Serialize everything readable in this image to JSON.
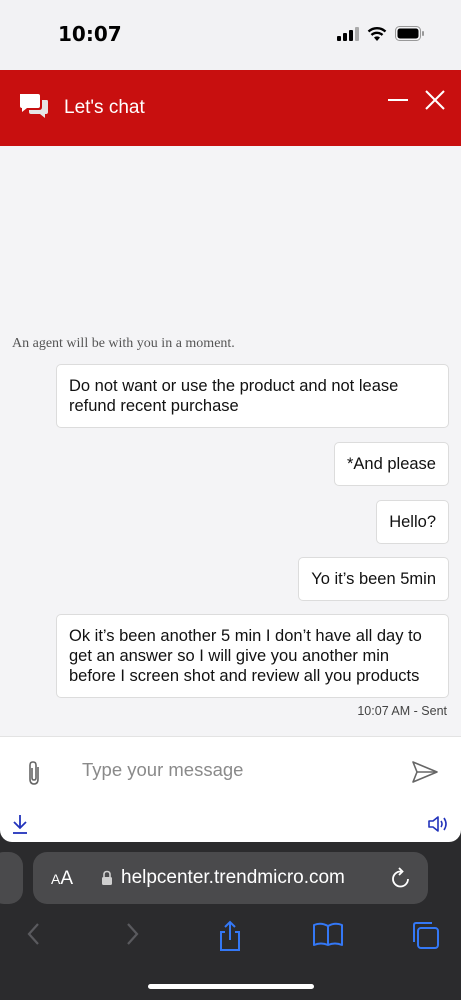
{
  "status_bar": {
    "time": "10:07"
  },
  "header": {
    "title": "Let's chat",
    "color": "#c80f0f"
  },
  "chat": {
    "agent_note": "An agent will be with you in a moment.",
    "messages": [
      {
        "text": "Do not want or use the product and not lease refund recent purchase"
      },
      {
        "text": "*And please"
      },
      {
        "text": "Hello?"
      },
      {
        "text": "Yo it’s been 5min"
      },
      {
        "text": "Ok it’s been another 5 min I don’t have all day to get an answer so I will give you another min before I screen shot and review all you products"
      }
    ],
    "sent_meta": "10:07 AM - Sent"
  },
  "composer": {
    "placeholder": "Type your message"
  },
  "browser": {
    "aa_big": "A",
    "aa_small": "A",
    "url": "helpcenter.trendmicro.com"
  },
  "colors": {
    "accent": "#c80f0f",
    "link": "#3478f6",
    "chat_bg": "#f4f4f6"
  },
  "icons": [
    "chat-bubbles-icon",
    "minimize-icon",
    "close-icon",
    "paperclip-icon",
    "send-icon",
    "download-icon",
    "speaker-icon",
    "lock-icon",
    "reload-icon",
    "back-icon",
    "forward-icon",
    "share-icon",
    "bookmarks-icon",
    "tabs-icon"
  ]
}
